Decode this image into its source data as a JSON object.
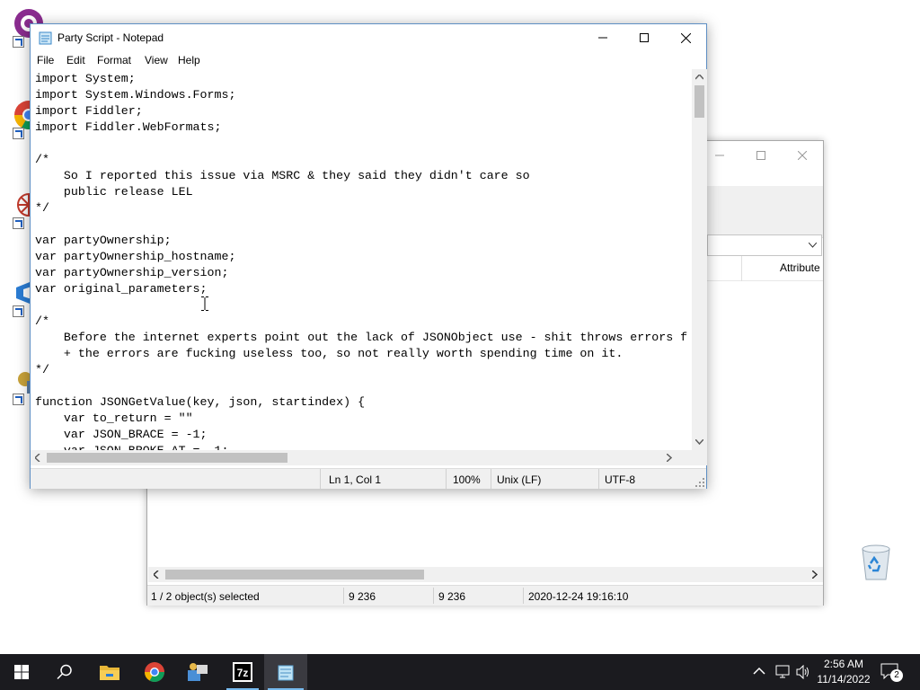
{
  "notepad": {
    "title": "Party Script - Notepad",
    "menu": [
      "File",
      "Edit",
      "Format",
      "View",
      "Help"
    ],
    "content": "import System;\nimport System.Windows.Forms;\nimport Fiddler;\nimport Fiddler.WebFormats;\n\n/*\n    So I reported this issue via MSRC & they said they didn't care so\n    public release LEL\n*/\n\nvar partyOwnership;\nvar partyOwnership_hostname;\nvar partyOwnership_version;\nvar original_parameters;\n\n/*\n    Before the internet experts point out the lack of JSONObject use - shit throws errors f\n    + the errors are fucking useless too, so not really worth spending time on it.\n*/\n\nfunction JSONGetValue(key, json, startindex) {\n    var to_return = \"\"\n    var JSON_BRACE = -1;\n    var JSON_BROKE_AT = -1;",
    "status": {
      "position": "Ln 1, Col 1",
      "zoom": "100%",
      "line_ending": "Unix (LF)",
      "encoding": "UTF-8"
    }
  },
  "archive_window": {
    "column_header": "Attribute",
    "status": {
      "selection": "1 / 2 object(s) selected",
      "size": "9 236",
      "packed_size": "9 236",
      "modified": "2020-12-24 19:16:10"
    }
  },
  "taskbar": {
    "time": "2:56 AM",
    "date": "11/14/2022",
    "notification_count": "2",
    "pinned": [
      "start-icon",
      "search-icon",
      "file-explorer-icon",
      "chrome-icon",
      "setup-icon",
      "7zip-icon",
      "notepad-icon"
    ]
  },
  "colors": {
    "taskbar_bg": "#1b1b1f",
    "accent": "#76b9ed",
    "notepad_border": "#5e8fc4"
  }
}
